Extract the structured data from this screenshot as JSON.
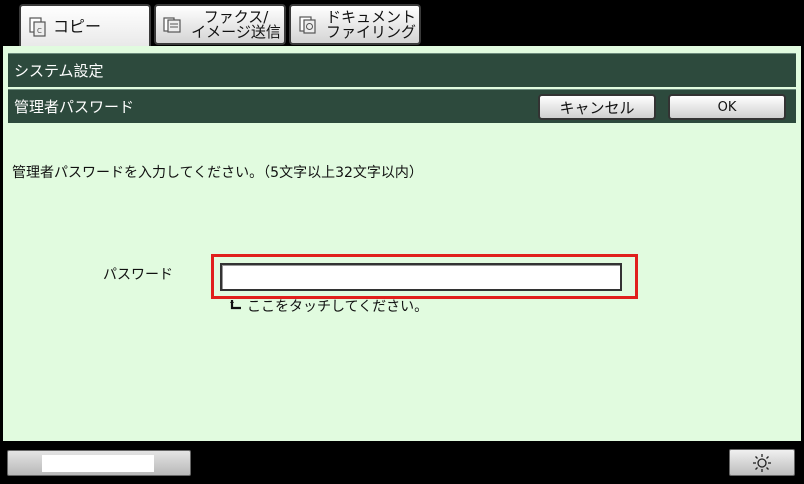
{
  "tabs": [
    {
      "label": "コピー",
      "icon": "copy-icon"
    },
    {
      "label_line1": "ファクス/",
      "label_line2": "イメージ送信",
      "icon": "fax-icon"
    },
    {
      "label_line1": "ドキュメント",
      "label_line2": "ファイリング",
      "icon": "document-filing-icon"
    }
  ],
  "header": {
    "section_title": "システム設定",
    "page_title": "管理者パスワード",
    "cancel_label": "キャンセル",
    "ok_label": "OK"
  },
  "main": {
    "instruction": "管理者パスワードを入力してください。（5文字以上32文字以内）",
    "password_label": "パスワード",
    "password_value": "",
    "hint": "ここをタッチしてください。"
  },
  "footer": {
    "brightness_icon": "brightness-icon"
  },
  "colors": {
    "panel_bg": "#e1fbdf",
    "header_bar": "#2d4a3d",
    "highlight": "#e0201c"
  }
}
